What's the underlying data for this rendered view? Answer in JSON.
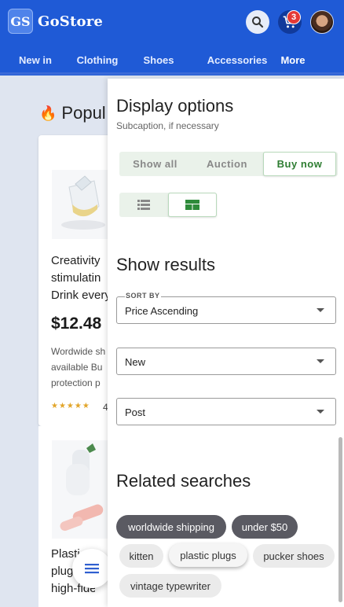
{
  "header": {
    "logo_letters": "GS",
    "brand": "GoStore",
    "cart_count": "3",
    "nav": [
      "New in",
      "Clothing",
      "Shoes",
      "Accessories",
      "More"
    ],
    "active_nav": "More"
  },
  "background": {
    "section_title": "Popul",
    "card": {
      "title_lines": [
        "Creativity",
        "stimulatin",
        "Drink every"
      ],
      "price": "$12.48",
      "desc_lines": [
        "Wordwide sh",
        "available Bu",
        "protection p"
      ],
      "stars": "★★★★★",
      "rating": "4"
    },
    "card2": {
      "title_lines": [
        "Plasti",
        "plug",
        "high-fideli"
      ]
    }
  },
  "drawer": {
    "title": "Display options",
    "subtitle": "Subcaption, if necessary",
    "filter_segments": [
      "Show all",
      "Auction",
      "Buy now"
    ],
    "selected_segment": "Buy now",
    "view_modes": [
      "list-view-icon",
      "grid-view-icon"
    ],
    "selected_view": "grid-view-icon",
    "show_results_title": "Show results",
    "sort": {
      "label": "SORT BY",
      "value": "Price Ascending"
    },
    "condition": {
      "value": "New"
    },
    "listing": {
      "value": "Post"
    },
    "related_title": "Related searches",
    "chips": [
      "worldwide shipping",
      "under $50",
      "kitten",
      "plastic plugs",
      "pucker shoes",
      "vintage typewriter"
    ]
  },
  "colors": {
    "appbar": "#1f5ad6",
    "accent_green": "#2e7d32",
    "badge": "#e53935"
  }
}
